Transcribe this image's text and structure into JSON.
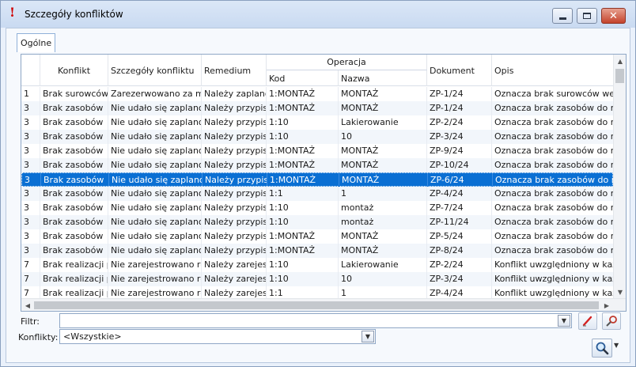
{
  "window": {
    "title": "Szczegóły konfliktów"
  },
  "tabs": [
    {
      "label": "Ogólne"
    }
  ],
  "table": {
    "headers": {
      "konflikt": "Konflikt",
      "szczegoly": "Szczegóły konfliktu",
      "remedium": "Remedium",
      "operacja": "Operacja",
      "kod": "Kod",
      "nazwa": "Nazwa",
      "dokument": "Dokument",
      "opis": "Opis"
    },
    "rows": [
      [
        "1",
        "Brak surowców",
        "Zarezerwowano za mał",
        "Należy zaplanow",
        "1:MONTAŻ",
        "MONTAŻ",
        "ZP-1/24",
        "Oznacza brak surowców we w"
      ],
      [
        "3",
        "Brak zasobów",
        "Nie udało się zaplanowa",
        "Należy przypisać",
        "1:MONTAŻ",
        "MONTAŻ",
        "ZP-1/24",
        "Oznacza brak zasobów do rea"
      ],
      [
        "3",
        "Brak zasobów",
        "Nie udało się zaplanowa",
        "Należy przypisać",
        "1:10",
        "Lakierowanie",
        "ZP-2/24",
        "Oznacza brak zasobów do rea"
      ],
      [
        "3",
        "Brak zasobów",
        "Nie udało się zaplanowa",
        "Należy przypisać",
        "1:10",
        "10",
        "ZP-3/24",
        "Oznacza brak zasobów do rea"
      ],
      [
        "3",
        "Brak zasobów",
        "Nie udało się zaplanowa",
        "Należy przypisać",
        "1:MONTAŻ",
        "MONTAŻ",
        "ZP-9/24",
        "Oznacza brak zasobów do rea"
      ],
      [
        "3",
        "Brak zasobów",
        "Nie udało się zaplanowa",
        "Należy przypisać",
        "1:MONTAŻ",
        "MONTAŻ",
        "ZP-10/24",
        "Oznacza brak zasobów do rea"
      ],
      [
        "3",
        "Brak zasobów",
        "Nie udało się zaplanowa",
        "Należy przypisać",
        "1:MONTAŻ",
        "MONTAŻ",
        "ZP-6/24",
        "Oznacza brak zasobów do rea"
      ],
      [
        "3",
        "Brak zasobów",
        "Nie udało się zaplanowa",
        "Należy przypisać",
        "1:1",
        "1",
        "ZP-4/24",
        "Oznacza brak zasobów do rea"
      ],
      [
        "3",
        "Brak zasobów",
        "Nie udało się zaplanowa",
        "Należy przypisać",
        "1:10",
        "montaż",
        "ZP-7/24",
        "Oznacza brak zasobów do rea"
      ],
      [
        "3",
        "Brak zasobów",
        "Nie udało się zaplanowa",
        "Należy przypisać",
        "1:10",
        "montaż",
        "ZP-11/24",
        "Oznacza brak zasobów do rea"
      ],
      [
        "3",
        "Brak zasobów",
        "Nie udało się zaplanowa",
        "Należy przypisać",
        "1:MONTAŻ",
        "MONTAŻ",
        "ZP-5/24",
        "Oznacza brak zasobów do rea"
      ],
      [
        "3",
        "Brak zasobów",
        "Nie udało się zaplanowa",
        "Należy przypisać",
        "1:MONTAŻ",
        "MONTAŻ",
        "ZP-8/24",
        "Oznacza brak zasobów do rea"
      ],
      [
        "7",
        "Brak realizacji po",
        "Nie zarejestrowano real",
        "Należy zarejestr",
        "1:10",
        "Lakierowanie",
        "ZP-2/24",
        "Konflikt uwzględniony w każdy"
      ],
      [
        "7",
        "Brak realizacji po",
        "Nie zarejestrowano real",
        "Należy zarejestr",
        "1:10",
        "10",
        "ZP-3/24",
        "Konflikt uwzględniony w każdy"
      ],
      [
        "7",
        "Brak realizacji po",
        "Nie zarejestrowano real",
        "Należy zarejestr",
        "1:1",
        "1",
        "ZP-4/24",
        "Konflikt uwzględniony w każdy"
      ]
    ],
    "selected_row": 6
  },
  "filter": {
    "label": "Filtr:",
    "value": ""
  },
  "konflikty": {
    "label": "Konflikty:",
    "value": "<Wszystkie>"
  },
  "icons": {
    "title": "exclamation-icon",
    "clear_filter": "clear-filter-icon",
    "filter_options": "filter-options-icon",
    "search": "magnifier-icon"
  }
}
